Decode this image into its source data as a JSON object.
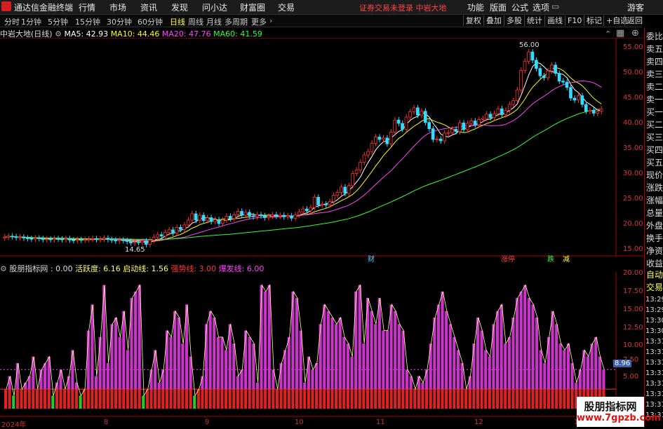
{
  "app": {
    "title": "通达信金融终端",
    "menu": [
      "行情",
      "市场",
      "资讯",
      "发现",
      "问小达",
      "财富圈",
      "交易"
    ],
    "notice": "证券交易未登录  中岩大地",
    "right_menu": [
      "功能",
      "版面",
      "公式",
      "选项"
    ],
    "guest": "游客"
  },
  "periods": [
    "分时",
    "1分钟",
    "5分钟",
    "15分钟",
    "30分钟",
    "60分钟",
    "日线",
    "周线",
    "月线",
    "多周期",
    "更多"
  ],
  "active_period": "日线",
  "toolbar_right": [
    "复权",
    "叠加",
    "多股",
    "统计",
    "画线",
    "F10",
    "标记",
    "+自选",
    "返回"
  ],
  "stock": {
    "name": "中岩大地(日线)",
    "ma": [
      {
        "label": "MA5: 42.93",
        "color": "#ffffff"
      },
      {
        "label": "MA10: 44.46",
        "color": "#ffff00"
      },
      {
        "label": "MA20: 47.76",
        "color": "#ff44ff"
      },
      {
        "label": "MA60: 41.59",
        "color": "#33ff33"
      }
    ]
  },
  "price_axis": [
    "55.00",
    "50.00",
    "45.00",
    "40.00",
    "35.00",
    "30.00",
    "25.00",
    "20.00",
    "15.00"
  ],
  "price_marks": {
    "high": "56.00",
    "low": "14.65"
  },
  "event_labels": [
    "财",
    "涨停",
    "跌",
    "减"
  ],
  "indicator": {
    "title": "股朋指标网 : 0.00",
    "fields": [
      {
        "label": "活跃度: 6.16",
        "color": "#ffff66"
      },
      {
        "label": "启动线: 1.56",
        "color": "#ffff66"
      },
      {
        "label": "强势线: 3.00",
        "color": "#ff3333"
      },
      {
        "label": "爆发线: 6.00",
        "color": "#ff44ff"
      }
    ]
  },
  "indicator_axis": [
    "20.00",
    "17.50",
    "15.00",
    "12.50",
    "10.00",
    "7.50",
    "5.00"
  ],
  "indicator_value": "8.96",
  "dates": [
    "2024年",
    "8",
    "9",
    "10",
    "11",
    "12",
    "1"
  ],
  "side_panel": {
    "labels": [
      "委比",
      "卖五",
      "卖四",
      "卖三",
      "卖二",
      "卖一",
      "买一",
      "买二",
      "买三",
      "买四",
      "买五",
      "现价",
      "涨跌",
      "涨幅",
      "总量",
      "外盘",
      "换手",
      "净资",
      "收益"
    ],
    "lower": [
      "自动",
      "交易"
    ],
    "times": [
      "13:29",
      "13:29",
      "13:30",
      "13:30",
      "13:31",
      "13:31",
      "13:31",
      "13:31",
      "13:31",
      "13:31",
      "13:31",
      "13:31"
    ]
  },
  "watermark": {
    "line1": "股朋指标网",
    "line2": "www.7gpzb.com"
  },
  "chart_data": {
    "type": "candlestick",
    "ylim": [
      13,
      58
    ],
    "close": [
      17,
      17.2,
      17.1,
      16.9,
      17,
      16.8,
      16.7,
      16.6,
      16.8,
      16.7,
      16.5,
      16.6,
      16.5,
      16.7,
      16.6,
      16.5,
      16.7,
      16.4,
      16.3,
      16.5,
      16.4,
      16.5,
      16.6,
      16.7,
      16.5,
      16.6,
      16.8,
      16.5,
      16.4,
      16.2,
      16.4,
      16.3,
      16.1,
      15.8,
      16,
      15.9,
      16.2,
      15.5,
      16.4,
      17,
      17.5,
      17.2,
      18,
      18.5,
      17.8,
      19,
      18.6,
      19.5,
      20.5,
      21.8,
      20.5,
      21.5,
      20.4,
      21,
      20.2,
      20.6,
      19.8,
      20.5,
      21.3,
      20.8,
      21.6,
      22.3,
      21.5,
      22.1,
      21.4,
      21.2,
      21.6,
      21.4,
      21,
      21.3,
      21.6,
      21.3,
      21.5,
      21.2,
      21.4,
      20.9,
      21.6,
      22.2,
      22.8,
      22.4,
      23.1,
      25.2,
      23.6,
      23.8,
      23.6,
      24.3,
      25.6,
      26.2,
      27.3,
      26,
      27.6,
      30.1,
      30.8,
      32.4,
      33.9,
      34.6,
      36.3,
      37.6,
      37.1,
      37.4,
      36.2,
      38.6,
      41.1,
      40.4,
      39.2,
      41.7,
      42.8,
      43.6,
      42.1,
      42.9,
      40.6,
      39.3,
      37.1,
      37.2,
      36.8,
      38.4,
      38.5,
      39.2,
      38.7,
      40.5,
      39.1,
      40.4,
      40.9,
      40.1,
      41.2,
      41.4,
      42.3,
      41.6,
      42.4,
      43.4,
      42.2,
      43.1,
      44.3,
      45.1,
      47.3,
      51.3,
      53.2,
      55.1,
      53.4,
      51.7,
      50.2,
      49.8,
      51.2,
      52.4,
      50.7,
      49.1,
      48.9,
      47.8,
      45.6,
      45.2,
      46.1,
      44.3,
      42.9,
      43.1,
      42.5,
      42.9,
      43.4
    ],
    "open": [
      16.8,
      17,
      17.2,
      17.1,
      16.9,
      17,
      16.8,
      16.7,
      16.6,
      16.8,
      16.7,
      16.5,
      16.6,
      16.5,
      16.7,
      16.6,
      16.5,
      16.7,
      16.4,
      16.3,
      16.5,
      16.4,
      16.5,
      16.6,
      16.7,
      16.5,
      16.6,
      16.8,
      16.5,
      16.4,
      16.2,
      16.4,
      16.3,
      16.1,
      15.8,
      16,
      15.9,
      16.2,
      15.5,
      16.4,
      17,
      17.5,
      17.2,
      18,
      18.5,
      17.8,
      19,
      18.6,
      19.5,
      20.5,
      21.8,
      20.5,
      21.5,
      20.4,
      21,
      20.2,
      20.6,
      19.8,
      20.5,
      21.3,
      20.8,
      21.6,
      22.3,
      21.5,
      22.1,
      21.4,
      21.2,
      21.6,
      21.4,
      21,
      21.3,
      21.6,
      21.3,
      21.5,
      21.2,
      21.4,
      20.9,
      21.6,
      22.2,
      22.8,
      22.4,
      23.1,
      25.2,
      23.6,
      23.8,
      23.6,
      24.3,
      25.6,
      26.2,
      27.3,
      26,
      27.6,
      30.1,
      30.8,
      32.4,
      33.9,
      34.6,
      36.3,
      37.6,
      37.1,
      37.4,
      36.2,
      38.6,
      41.1,
      40.4,
      39.2,
      41.7,
      42.8,
      43.6,
      42.1,
      42.9,
      40.6,
      39.3,
      37.1,
      37.2,
      36.8,
      38.4,
      38.5,
      39.2,
      38.7,
      40.5,
      39.1,
      40.4,
      40.9,
      40.1,
      41.2,
      41.4,
      42.3,
      41.6,
      42.4,
      43.4,
      42.2,
      43.1,
      44.3,
      45.1,
      47.3,
      51.3,
      53.2,
      55.1,
      53.4,
      51.7,
      50.2,
      49.8,
      51.2,
      52.4,
      50.7,
      49.1,
      48.9,
      47.8,
      45.6,
      45.2,
      46.1,
      44.3,
      42.9,
      43.1,
      42.5,
      42.9
    ],
    "indicator_bars": [
      3,
      5,
      2,
      7,
      3,
      4,
      5,
      8,
      3,
      6,
      7,
      8,
      2,
      4,
      6,
      3,
      5,
      9,
      4,
      2,
      3,
      12,
      16,
      5,
      11,
      19,
      7,
      13,
      14,
      11,
      15,
      9,
      17,
      18,
      19,
      2,
      3,
      6,
      9,
      4,
      6,
      12,
      11,
      15,
      14,
      10,
      16,
      8,
      2,
      3,
      5,
      13,
      15,
      14,
      11,
      11,
      9,
      13,
      10,
      5,
      6,
      12,
      11,
      10,
      4,
      19,
      18,
      19,
      6,
      3,
      7,
      9,
      11,
      18,
      17,
      12,
      4,
      8,
      6,
      7,
      13,
      16,
      15,
      14,
      13,
      14,
      11,
      10,
      8,
      18,
      19,
      10,
      17,
      15,
      13,
      17,
      12,
      12,
      16,
      15,
      13,
      12,
      6,
      5,
      3,
      5,
      4,
      6,
      10,
      14,
      16,
      18,
      15,
      13,
      11,
      9,
      7,
      3,
      5,
      10,
      14,
      12,
      9,
      8,
      13,
      15,
      16,
      10,
      11,
      14,
      17,
      18,
      19,
      17,
      16,
      14,
      9,
      7,
      11,
      15,
      13,
      10,
      9,
      10,
      7,
      4,
      6,
      9,
      8,
      10,
      11,
      8,
      6
    ],
    "volume_colors_note": "red/green lower bars"
  }
}
